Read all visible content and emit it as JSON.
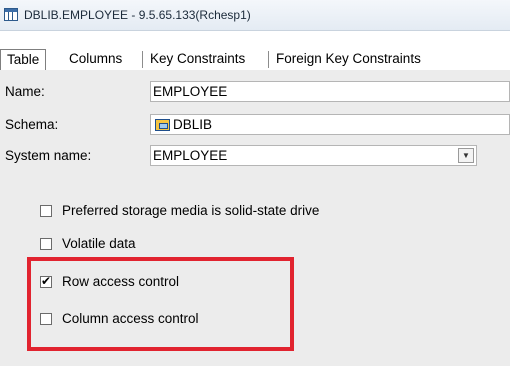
{
  "window": {
    "title": "DBLIB.EMPLOYEE - 9.5.65.133(Rchesp1)"
  },
  "tabs": [
    {
      "label": "Table",
      "active": true
    },
    {
      "label": "Columns",
      "active": false
    },
    {
      "label": "Key Constraints",
      "active": false
    },
    {
      "label": "Foreign Key Constraints",
      "active": false
    }
  ],
  "fields": {
    "name": {
      "label": "Name:",
      "value": "EMPLOYEE"
    },
    "schema": {
      "label": "Schema:",
      "value": "DBLIB",
      "icon": "schema-icon"
    },
    "system_name": {
      "label": "System name:",
      "value": "EMPLOYEE"
    }
  },
  "options": [
    {
      "label": "Preferred storage media is solid-state drive",
      "checked": false
    },
    {
      "label": "Volatile data",
      "checked": false
    },
    {
      "label": "Row access control",
      "checked": true
    },
    {
      "label": "Column access control",
      "checked": false
    }
  ],
  "colors": {
    "highlight": "#e1232f",
    "panel": "#ececec"
  }
}
